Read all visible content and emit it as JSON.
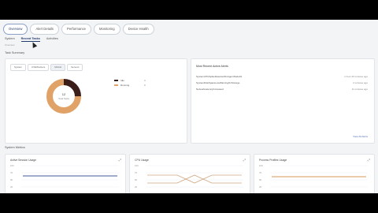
{
  "tabs": [
    "Overview",
    "Alert Details",
    "Performance",
    "Monitoring",
    "Device Health"
  ],
  "active_tab": 0,
  "subnav": {
    "items": [
      "System",
      "Recent Tasks",
      "Activities"
    ],
    "active": 1,
    "sub": "Overview"
  },
  "summary": {
    "label": "Task Summary",
    "tabs": [
      "System",
      "CVEWorkers",
      "MACH",
      "Servers"
    ],
    "active_tab": 2,
    "donut": {
      "center_title": "12",
      "center_sub": "Total Tasks",
      "segments": [
        {
          "label": "Idle",
          "fraction": 0.25,
          "color": "#3b1d1a",
          "value": "3"
        },
        {
          "label": "Running",
          "fraction": 0.75,
          "color": "#e0a267",
          "value": "9"
        }
      ]
    }
  },
  "activity": {
    "title": "Most Recent Active Alerts",
    "rows": [
      {
        "name": "SystemCPUSpikeDetectedOnAgentNode01",
        "time": "1 hour 20 minutes ago"
      },
      {
        "name": "SystemDiskSpaceLowWarningOnStorage",
        "time": "2 minutes ago"
      },
      {
        "name": "NetworkLatencyIncreased",
        "time": "11 minutes ago"
      }
    ],
    "view_all": "View All Alerts"
  },
  "metrics": {
    "label": "System Metrics",
    "panels": [
      {
        "title": "Active Session Usage",
        "icon": "expand-icon",
        "yticks": [
          "100",
          "75",
          "50",
          "25"
        ]
      },
      {
        "title": "CPU Usage",
        "icon": "expand-icon",
        "yticks": [
          "100",
          "75",
          "50",
          "25"
        ]
      },
      {
        "title": "Process Profiles Usage",
        "icon": "expand-icon",
        "yticks": [
          "100",
          "75",
          "50",
          "25"
        ]
      }
    ]
  },
  "colors": {
    "navy_line": "#3f5a97",
    "tan_line": "#cfa780",
    "orange_line": "#d69a5a"
  }
}
